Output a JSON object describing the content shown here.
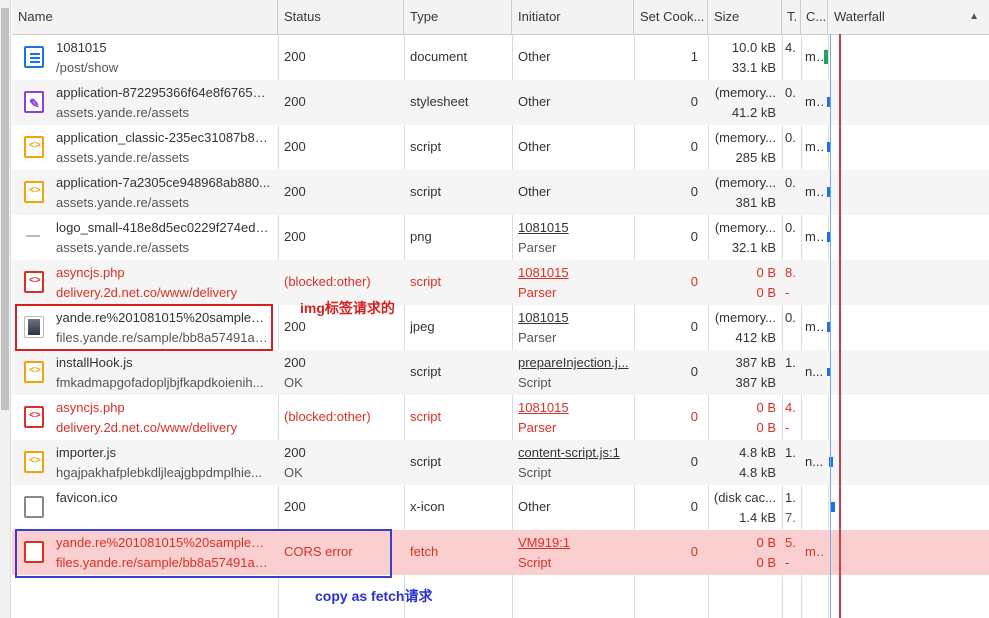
{
  "headers": {
    "name": "Name",
    "status": "Status",
    "type": "Type",
    "initiator": "Initiator",
    "setcookies": "Set Cook...",
    "size": "Size",
    "time": "T.",
    "cookies": "C...",
    "waterfall": "Waterfall",
    "sort_icon": "▲"
  },
  "rows": [
    {
      "name": "1081015",
      "path": "/post/show",
      "status": "200",
      "status2": "",
      "type": "document",
      "initiator": "Other",
      "initiator2": "",
      "setc": "1",
      "size1": "10.0 kB",
      "size2": "33.1 kB",
      "t1": "4.",
      "t2": "",
      "c": "m...",
      "icon": "document-icon"
    },
    {
      "name": "application-872295366f64e8f67657...",
      "path": "assets.yande.re/assets",
      "status": "200",
      "status2": "",
      "type": "stylesheet",
      "initiator": "Other",
      "initiator2": "",
      "setc": "0",
      "size1": "(memory...",
      "size2": "41.2 kB",
      "t1": "0.",
      "t2": "",
      "c": "m...",
      "icon": "stylesheet-icon"
    },
    {
      "name": "application_classic-235ec31087b89...",
      "path": "assets.yande.re/assets",
      "status": "200",
      "status2": "",
      "type": "script",
      "initiator": "Other",
      "initiator2": "",
      "setc": "0",
      "size1": "(memory...",
      "size2": "285 kB",
      "t1": "0.",
      "t2": "",
      "c": "m...",
      "icon": "script-icon"
    },
    {
      "name": "application-7a2305ce948968ab880...",
      "path": "assets.yande.re/assets",
      "status": "200",
      "status2": "",
      "type": "script",
      "initiator": "Other",
      "initiator2": "",
      "setc": "0",
      "size1": "(memory...",
      "size2": "381 kB",
      "t1": "0.",
      "t2": "",
      "c": "m...",
      "icon": "script-icon"
    },
    {
      "name": "logo_small-418e8d5ec0229f274ede...",
      "path": "assets.yande.re/assets",
      "status": "200",
      "status2": "",
      "type": "png",
      "initiator": "1081015",
      "initiator2": "Parser",
      "setc": "0",
      "size1": "(memory...",
      "size2": "32.1 kB",
      "t1": "0.",
      "t2": "",
      "c": "m...",
      "icon": "image-icon"
    },
    {
      "name": "asyncjs.php",
      "path": "delivery.2d.net.co/www/delivery",
      "status": "(blocked:other)",
      "status2": "",
      "type": "script",
      "initiator": "1081015",
      "initiator2": "Parser",
      "setc": "0",
      "size1": "0 B",
      "size2": "0 B",
      "t1": "8.",
      "t2": "-",
      "c": "",
      "icon": "script-icon"
    },
    {
      "name": "yande.re%201081015%20sample%...",
      "path": "files.yande.re/sample/bb8a57491a0...",
      "status": "200",
      "status2": "",
      "type": "jpeg",
      "initiator": "1081015",
      "initiator2": "Parser",
      "setc": "0",
      "size1": "(memory...",
      "size2": "412 kB",
      "t1": "0.",
      "t2": "",
      "c": "m...",
      "icon": "thumbnail-icon"
    },
    {
      "name": "installHook.js",
      "path": "fmkadmapgofadopljbjfkapdkoienih...",
      "status": "200",
      "status2": "OK",
      "type": "script",
      "initiator": "prepareInjection.j...",
      "initiator2": "Script",
      "setc": "0",
      "size1": "387 kB",
      "size2": "387 kB",
      "t1": "1.",
      "t2": "",
      "c": "n...",
      "icon": "script-icon"
    },
    {
      "name": "asyncjs.php",
      "path": "delivery.2d.net.co/www/delivery",
      "status": "(blocked:other)",
      "status2": "",
      "type": "script",
      "initiator": "1081015",
      "initiator2": "Parser",
      "setc": "0",
      "size1": "0 B",
      "size2": "0 B",
      "t1": "4.",
      "t2": "-",
      "c": "",
      "icon": "script-icon"
    },
    {
      "name": "importer.js",
      "path": "hgajpakhafplebkdljleajgbpdmplhie...",
      "status": "200",
      "status2": "OK",
      "type": "script",
      "initiator": "content-script.js:1",
      "initiator2": "Script",
      "setc": "0",
      "size1": "4.8 kB",
      "size2": "4.8 kB",
      "t1": "1.",
      "t2": "",
      "c": "n...",
      "icon": "script-icon"
    },
    {
      "name": "favicon.ico",
      "path": "",
      "status": "200",
      "status2": "",
      "type": "x-icon",
      "initiator": "Other",
      "initiator2": "",
      "setc": "0",
      "size1": "(disk cac...",
      "size2": "1.4 kB",
      "t1": "1.",
      "t2": "7.",
      "c": "",
      "icon": "file-icon"
    },
    {
      "name": "yande.re%201081015%20sample%...",
      "path": "files.yande.re/sample/bb8a57491a0...",
      "status": "CORS error",
      "status2": "",
      "type": "fetch",
      "initiator": "VM919:1",
      "initiator2": "Script",
      "setc": "0",
      "size1": "0 B",
      "size2": "0 B",
      "t1": "5.",
      "t2": "-",
      "c": "m...",
      "icon": "file-icon"
    }
  ],
  "annotations": {
    "img_label": "img标签请求的",
    "fetch_label": "copy as fetch请求"
  },
  "colors": {
    "error_red": "#d93025",
    "cors_bg": "#f9d0cf",
    "annotation_red": "#d81e1e",
    "annotation_blue": "#2a2fd0"
  }
}
